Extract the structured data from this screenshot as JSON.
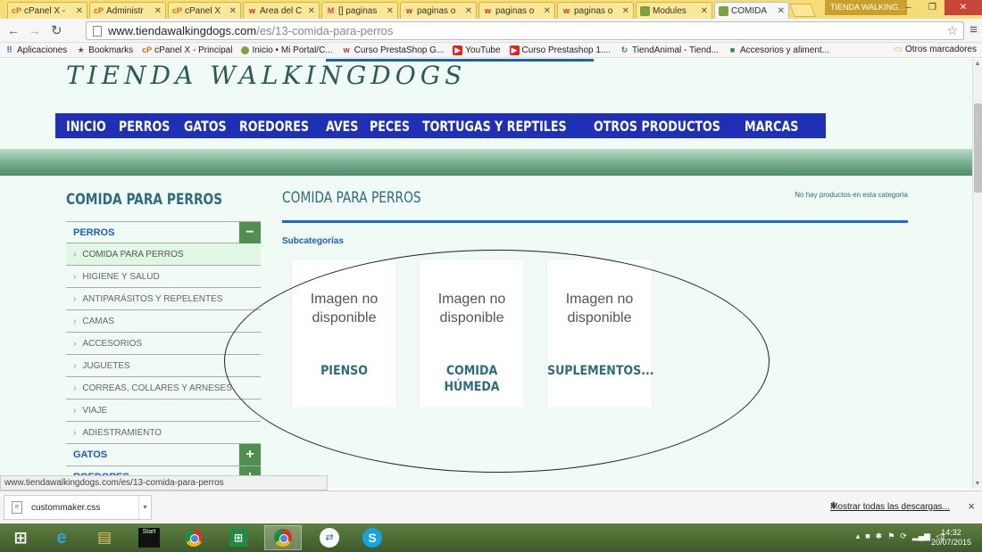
{
  "browser": {
    "tabs": [
      {
        "title": "cPanel X -",
        "favicon": "cpanel"
      },
      {
        "title": "Administr",
        "favicon": "cpanel"
      },
      {
        "title": "cPanel X",
        "favicon": "cpanel"
      },
      {
        "title": "Área del C",
        "favicon": "webempresa"
      },
      {
        "title": "[] paginas",
        "favicon": "gmail"
      },
      {
        "title": "paginas o",
        "favicon": "webempresa"
      },
      {
        "title": "paginas o",
        "favicon": "webempresa"
      },
      {
        "title": "paginas o",
        "favicon": "webempresa"
      },
      {
        "title": "Modules",
        "favicon": "prestashop"
      },
      {
        "title": "COMIDA",
        "favicon": "prestashop"
      }
    ],
    "window_user": "TIENDA WALKING...",
    "url_host": "www.tiendawalkingdogs.com",
    "url_path": "/es/13-comida-para-perros",
    "bookmarks": [
      {
        "label": "Aplicaciones",
        "icon": "apps-icon"
      },
      {
        "label": "Bookmarks",
        "icon": "star-icon"
      },
      {
        "label": "cPanel X - Principal",
        "icon": "cpanel-icon"
      },
      {
        "label": "Inicio • Mi Portal/C...",
        "icon": "prestashop-icon"
      },
      {
        "label": "Curso PrestaShop G...",
        "icon": "webempresa-icon"
      },
      {
        "label": "YouTube",
        "icon": "youtube-icon"
      },
      {
        "label": "Curso Prestashop 1....",
        "icon": "youtube-icon"
      },
      {
        "label": "TiendAnimal - Tiend...",
        "icon": "tiendanimal-icon"
      },
      {
        "label": "Accesorios y aliment...",
        "icon": "shop-icon"
      }
    ],
    "other_bookmarks": "Otros marcadores",
    "status_url": "www.tiendawalkingdogs.com/es/13-comida-para-perros"
  },
  "site": {
    "logo": "TIENDA WALKINGDOGS",
    "menu": [
      "INICIO",
      "PERROS",
      "GATOS",
      "ROEDORES",
      "AVES",
      "PECES",
      "TORTUGAS Y REPTILES",
      "OTROS PRODUCTOS",
      "MARCAS"
    ]
  },
  "sidebar": {
    "title": "COMIDA PARA PERROS",
    "section_perros": "PERROS",
    "toggle_collapse": "−",
    "toggle_expand": "+",
    "subitems": [
      "COMIDA PARA PERROS",
      "HIGIENE Y SALUD",
      "ANTIPARÁSITOS Y REPELENTES",
      "CAMAS",
      "ACCESORIOS",
      "JUGUETES",
      "CORREAS, COLLARES Y ARNESES",
      "VIAJE",
      "ADIESTRAMIENTO"
    ],
    "section_gatos": "GATOS",
    "section_roedores": "ROEDORES"
  },
  "content": {
    "title": "COMIDA PARA PERROS",
    "no_products": "No hay productos en esta categoría",
    "subcategories_label": "Subcategorías",
    "image_placeholder_line1": "Imagen no",
    "image_placeholder_line2": "disponible",
    "cards": [
      {
        "name_line1": "PIENSO",
        "name_line2": ""
      },
      {
        "name_line1": "COMIDA",
        "name_line2": "HÚMEDA"
      },
      {
        "name_line1": "SUPLEMENTOS...",
        "name_line2": ""
      }
    ]
  },
  "downloads": {
    "file": "custommaker.css",
    "show_all": "Mostrar todas las descargas...",
    "close": "×"
  },
  "taskbar": {
    "start_tile": "Start",
    "time": "14:32",
    "date": "20/07/2015"
  },
  "colors": {
    "menu_bg": "#1e30b5",
    "accent_green": "#4f8f4f",
    "title_teal": "#2e6b7b",
    "link_blue": "#1e5cbe"
  }
}
